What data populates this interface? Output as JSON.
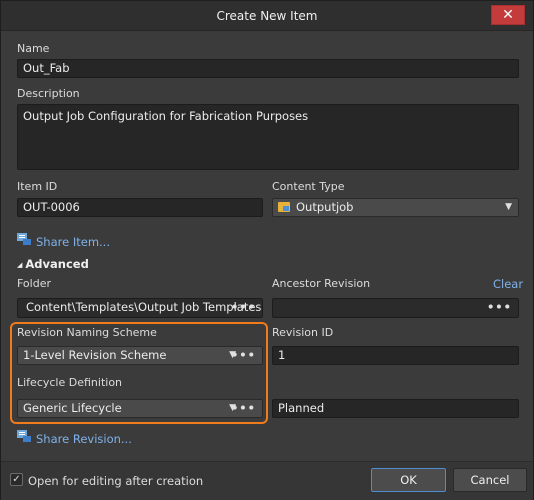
{
  "dialog": {
    "title": "Create New Item",
    "close_glyph": "✕"
  },
  "name": {
    "label": "Name",
    "value": "Out_Fab"
  },
  "description": {
    "label": "Description",
    "value": "Output Job Configuration for Fabrication Purposes"
  },
  "item_id": {
    "label": "Item ID",
    "value": "OUT-0006"
  },
  "content_type": {
    "label": "Content Type",
    "value": "Outputjob",
    "icon": "outputjob-icon"
  },
  "share_item": {
    "label": "Share Item..."
  },
  "advanced": {
    "toggle_glyph": "◢",
    "label": "Advanced"
  },
  "folder": {
    "label": "Folder",
    "value": "Content\\Templates\\Output Job Templates"
  },
  "ancestor_revision": {
    "label": "Ancestor Revision",
    "clear_label": "Clear",
    "value": ""
  },
  "revision_naming": {
    "label": "Revision Naming Scheme",
    "value": "1-Level Revision Scheme"
  },
  "revision_id": {
    "label": "Revision ID",
    "value": "1"
  },
  "lifecycle": {
    "label": "Lifecycle Definition",
    "value": "Generic Lifecycle",
    "state_value": "Planned"
  },
  "share_revision": {
    "label": "Share Revision..."
  },
  "footer": {
    "open_for_editing_label": "Open for editing after creation",
    "open_for_editing_checked": true,
    "ok_label": "OK",
    "cancel_label": "Cancel"
  },
  "glyphs": {
    "dropdown": "▼",
    "dots": "•••",
    "check": "✓"
  },
  "colors": {
    "highlight": "#f07b1a",
    "link": "#7fb2ea",
    "close": "#c43b3b",
    "ok_border": "#4c8ccf"
  }
}
